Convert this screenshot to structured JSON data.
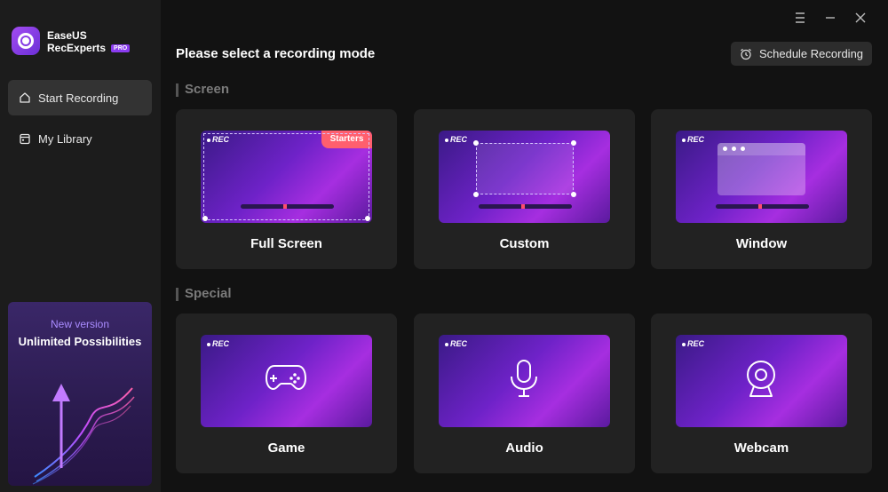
{
  "app": {
    "brand_line1": "EaseUS",
    "brand_line2": "RecExperts",
    "pro_badge": "PRO"
  },
  "sidebar": {
    "items": [
      {
        "label": "Start Recording",
        "icon": "home-icon",
        "active": true
      },
      {
        "label": "My Library",
        "icon": "library-icon",
        "active": false
      }
    ],
    "promo": {
      "subtitle": "New version",
      "title": "Unlimited Possibilities"
    }
  },
  "titlebar": {
    "icons": [
      "menu-icon",
      "minimize-icon",
      "close-icon"
    ]
  },
  "main": {
    "heading": "Please select a recording mode",
    "schedule_label": "Schedule Recording",
    "sections": [
      {
        "title": "Screen",
        "modes": [
          {
            "label": "Full Screen",
            "badge": "Starters"
          },
          {
            "label": "Custom"
          },
          {
            "label": "Window"
          }
        ]
      },
      {
        "title": "Special",
        "modes": [
          {
            "label": "Game",
            "icon": "gamepad-icon"
          },
          {
            "label": "Audio",
            "icon": "microphone-icon"
          },
          {
            "label": "Webcam",
            "icon": "webcam-icon"
          }
        ]
      }
    ],
    "rec_label": "REC"
  },
  "colors": {
    "accent": "#8b3cf0",
    "badge": "#ff5f6e",
    "sidebar_bg": "#1c1c1c",
    "card_bg": "#222222"
  }
}
